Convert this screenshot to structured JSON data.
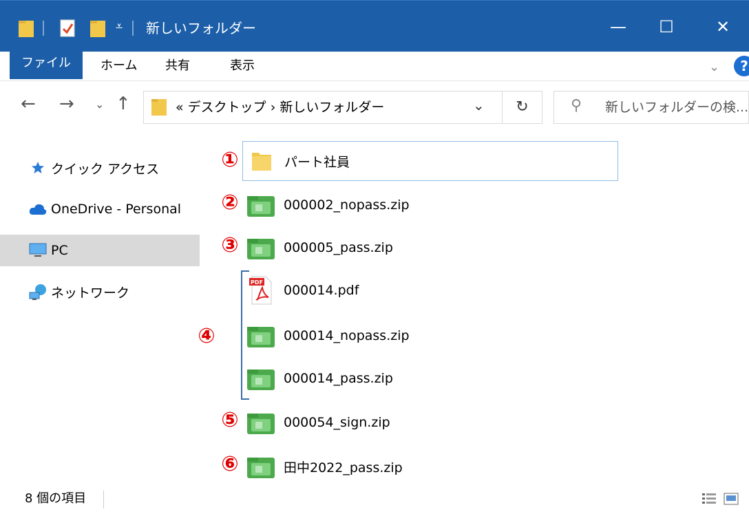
{
  "window": {
    "title": "新しいフォルダー",
    "controls": {
      "minimize": "—",
      "maximize": "☐",
      "close": "✕"
    }
  },
  "ribbon": {
    "tabs": [
      "ファイル",
      "ホーム",
      "共有",
      "表示"
    ],
    "expand_icon": "chevron-down-icon",
    "help": "?"
  },
  "navigation": {
    "back": "←",
    "forward": "→",
    "recent": "⌄",
    "up": "↑",
    "address_path": "« デスクトップ › 新しいフォルダー",
    "address_dropdown": "⌄",
    "refresh": "↻",
    "search_placeholder": "新しいフォルダーの検..."
  },
  "sidebar": {
    "items": [
      {
        "label": "クイック アクセス",
        "icon": "star-icon"
      },
      {
        "label": "OneDrive - Personal",
        "icon": "cloud-icon"
      },
      {
        "label": "PC",
        "icon": "monitor-icon",
        "selected": true
      },
      {
        "label": "ネットワーク",
        "icon": "network-icon"
      }
    ]
  },
  "files": [
    {
      "name": "パート社員",
      "type": "folder",
      "marker": "①",
      "selected": true
    },
    {
      "name": "000002_nopass.zip",
      "type": "zip",
      "marker": "②"
    },
    {
      "name": "000005_pass.zip",
      "type": "zip",
      "marker": "③"
    },
    {
      "name": "000014.pdf",
      "type": "pdf",
      "marker": ""
    },
    {
      "name": "000014_nopass.zip",
      "type": "zip",
      "marker": "④"
    },
    {
      "name": "000014_pass.zip",
      "type": "zip",
      "marker": ""
    },
    {
      "name": "000054_sign.zip",
      "type": "zip",
      "marker": "⑤"
    },
    {
      "name": "田中2022_pass.zip",
      "type": "zip",
      "marker": "⑥"
    }
  ],
  "pdf_badge": "PDF",
  "status": {
    "item_count": "8 個の項目"
  },
  "colors": {
    "accent": "#1c5fa8",
    "marker": "#e00000",
    "zip": "#4caa4c",
    "folder": "#f2c84b"
  }
}
